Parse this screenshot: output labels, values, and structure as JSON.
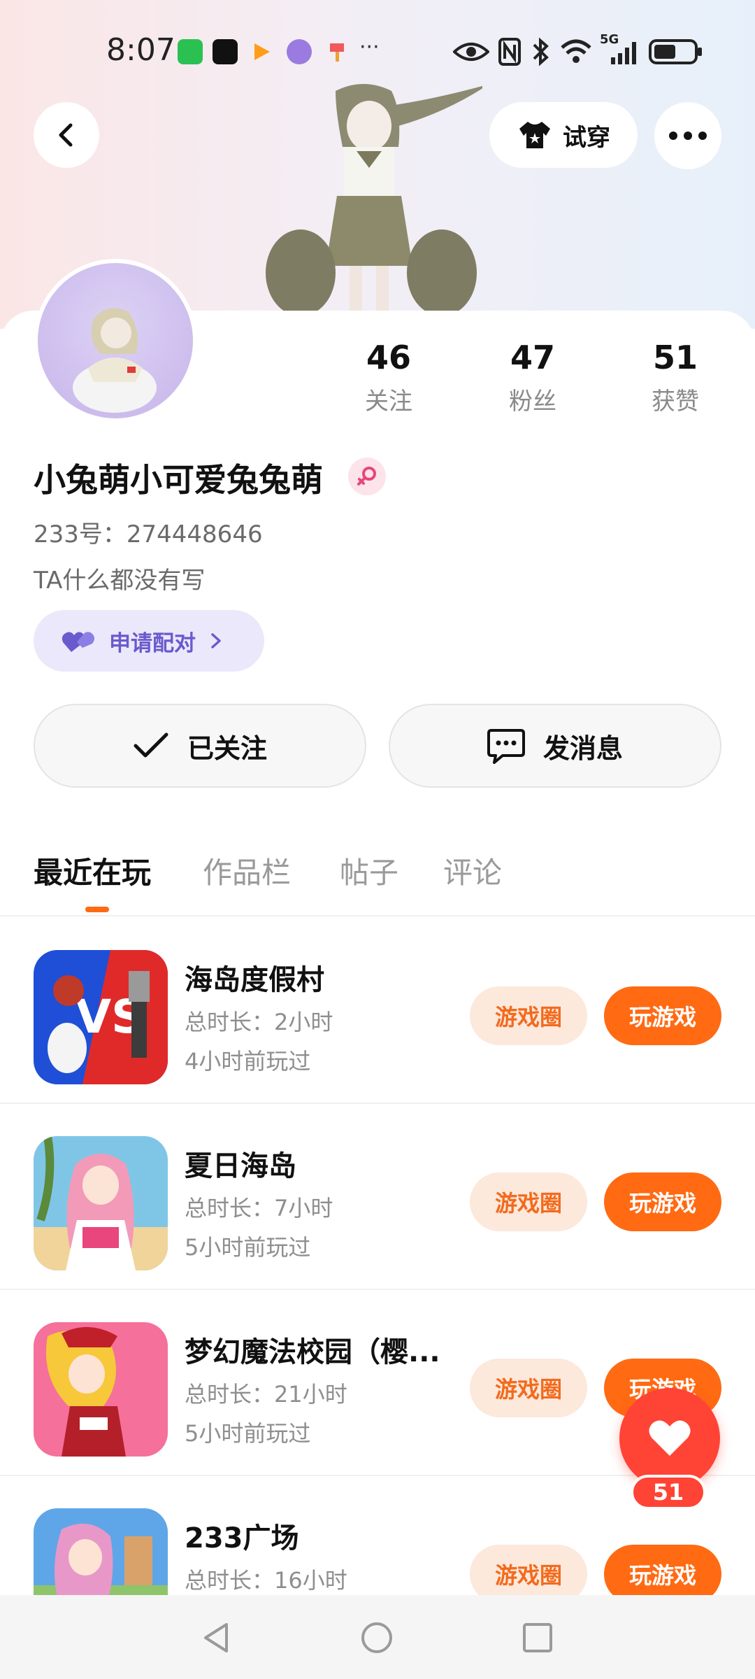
{
  "status_bar": {
    "time": "8:07",
    "icons": [
      "wechat-icon",
      "tiktok-icon",
      "video-app-icon",
      "browser-icon",
      "app-icon",
      "more-dots-icon",
      "eye-icon",
      "nfc-icon",
      "bluetooth-icon",
      "wifi-icon",
      "signal-5g-icon",
      "battery-icon"
    ],
    "signal_label": "5G"
  },
  "header": {
    "back_icon": "chevron-left-icon",
    "try_on_label": "试穿",
    "try_on_icon": "shirt-icon",
    "more_icon": "more-horizontal-icon"
  },
  "profile": {
    "stats": [
      {
        "value": "46",
        "label": "关注"
      },
      {
        "value": "47",
        "label": "粉丝"
      },
      {
        "value": "51",
        "label": "获赞"
      }
    ],
    "nickname": "小兔萌小可爱兔兔萌",
    "gender": "female-icon",
    "uid": "233号：274448646",
    "bio": "TA什么都没有写",
    "pair_button": "申请配对",
    "follow_button": "已关注",
    "message_button": "发消息"
  },
  "tabs": [
    {
      "label": "最近在玩",
      "active": true
    },
    {
      "label": "作品栏",
      "active": false
    },
    {
      "label": "帖子",
      "active": false
    },
    {
      "label": "评论",
      "active": false
    }
  ],
  "games": [
    {
      "name": "海岛度假村",
      "duration": "总时长：2小时",
      "last_played": "4小时前玩过",
      "circle_label": "游戏圈",
      "play_label": "玩游戏"
    },
    {
      "name": "夏日海岛",
      "duration": "总时长：7小时",
      "last_played": "5小时前玩过",
      "circle_label": "游戏圈",
      "play_label": "玩游戏"
    },
    {
      "name": "梦幻魔法校园（樱...",
      "duration": "总时长：21小时",
      "last_played": "5小时前玩过",
      "circle_label": "游戏圈",
      "play_label": "玩游戏"
    },
    {
      "name": "233广场",
      "duration": "总时长：16小时",
      "last_played": "",
      "circle_label": "游戏圈",
      "play_label": "玩游戏"
    }
  ],
  "float_like": {
    "count": "51",
    "icon": "heart-icon"
  },
  "colors": {
    "accent": "#ff6a13",
    "like": "#ff4334",
    "pair": "#6a5acd"
  }
}
